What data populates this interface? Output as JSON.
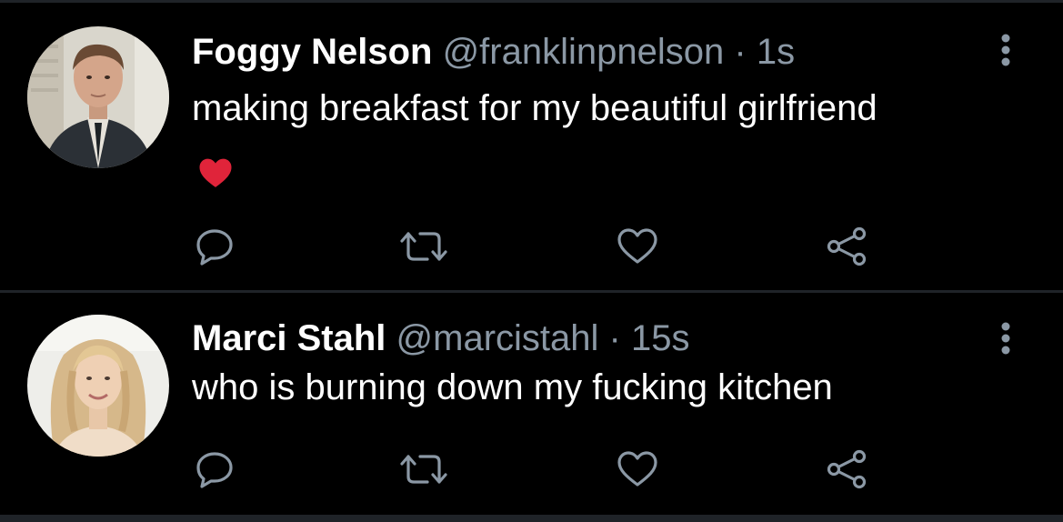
{
  "theme": {
    "background": "#000000",
    "text_primary": "#ffffff",
    "text_secondary": "#8b98a5",
    "divider": "#1f2328",
    "heart_emoji": "#e0243a"
  },
  "tweets": [
    {
      "name": "Foggy Nelson",
      "handle": "@franklinpnelson",
      "separator": "·",
      "time": "1s",
      "text": "making breakfast for my beautiful girlfriend",
      "emoji": "red-heart-emoji",
      "avatar": "avatar-man-in-suit",
      "more_icon": "vertical-ellipsis-icon",
      "actions": [
        "reply-icon",
        "retweet-icon",
        "like-icon",
        "share-icon"
      ]
    },
    {
      "name": "Marci Stahl",
      "handle": "@marcistahl",
      "separator": "·",
      "time": "15s",
      "text": "who is burning down my fucking kitchen",
      "avatar": "avatar-blonde-woman",
      "more_icon": "vertical-ellipsis-icon",
      "actions": [
        "reply-icon",
        "retweet-icon",
        "like-icon",
        "share-icon"
      ]
    }
  ]
}
